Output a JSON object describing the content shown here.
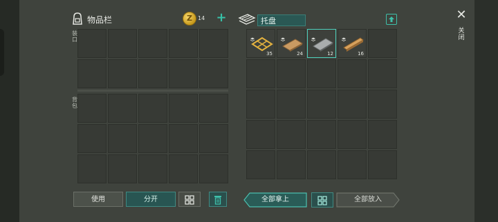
{
  "inventory": {
    "title": "物品栏",
    "coins": "14",
    "coin_symbol": "Z",
    "equip_label": "装口",
    "backpack_label": "背包"
  },
  "buttons": {
    "use": "使用",
    "split": "分开",
    "take_all": "全部拿上",
    "put_all": "全部放入"
  },
  "container": {
    "name": "托盘",
    "items": [
      {
        "name": "wood-frame",
        "qty": "35"
      },
      {
        "name": "wood-plank",
        "qty": "24"
      },
      {
        "name": "metal-sheet",
        "qty": "12"
      },
      {
        "name": "wood-beam",
        "qty": "16"
      }
    ]
  },
  "close_label": "关闭",
  "colors": {
    "accent": "#3ec1ab",
    "background": "#3f433d",
    "slot": "#373a35",
    "selected_slot": "#4fd1bd"
  }
}
